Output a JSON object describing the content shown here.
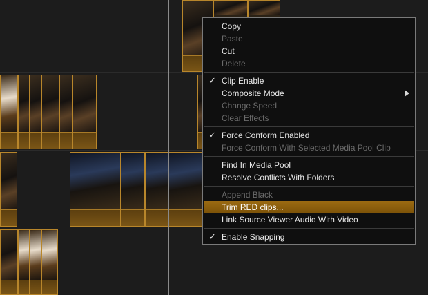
{
  "context_menu": {
    "copy": "Copy",
    "paste": "Paste",
    "cut": "Cut",
    "delete": "Delete",
    "clip_enable": "Clip Enable",
    "composite_mode": "Composite Mode",
    "change_speed": "Change Speed",
    "clear_effects": "Clear Effects",
    "force_conform_enabled": "Force Conform Enabled",
    "force_conform_selected": "Force Conform With Selected Media Pool Clip",
    "find_in_media_pool": "Find In Media Pool",
    "resolve_conflicts": "Resolve Conflicts With Folders",
    "append_black": "Append Black",
    "trim_red_clips": "Trim RED clips...",
    "link_source_viewer_audio": "Link Source Viewer Audio With Video",
    "enable_snapping": "Enable Snapping",
    "checked_items": [
      "Clip Enable",
      "Force Conform Enabled",
      "Enable Snapping"
    ],
    "highlighted_item": "Trim RED clips...",
    "disabled_items": [
      "Paste",
      "Delete",
      "Change Speed",
      "Clear Effects",
      "Force Conform With Selected Media Pool Clip",
      "Append Black"
    ]
  },
  "icons": {
    "check": "checkmark-icon",
    "submenu": "chevron-right-icon"
  },
  "colors": {
    "menu_background": "#0f0f0f",
    "highlight": "#8c5e0d",
    "clip_border": "#b8862b",
    "clip_band": "#6a4a13",
    "timeline_background": "#1c1c1c",
    "enabled_text": "#e6e6e6",
    "disabled_text": "#6a6a6a"
  }
}
